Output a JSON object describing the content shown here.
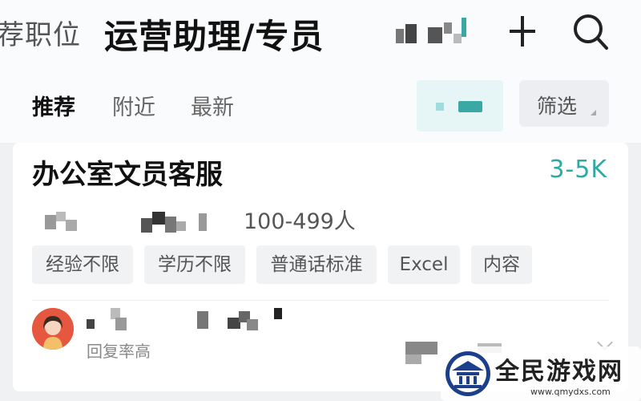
{
  "header": {
    "back_label": "荐职位",
    "title": "运营助理/专员",
    "add_icon": "plus-icon",
    "search_icon": "search-icon"
  },
  "tabs": [
    {
      "label": "推荐",
      "active": true
    },
    {
      "label": "附近",
      "active": false
    },
    {
      "label": "最新",
      "active": false
    }
  ],
  "filter": {
    "label": "筛选",
    "icon": "caret-icon"
  },
  "job": {
    "title": "办公室文员客服",
    "salary": "3-5K",
    "company_size": "100-499人",
    "tags": [
      "经验不限",
      "学历不限",
      "普通话标准",
      "Excel",
      "内容"
    ],
    "recruiter_status": "回复率高"
  },
  "watermark": {
    "text": "全民游戏网",
    "url": "www.qmydxs.com"
  },
  "colors": {
    "accent": "#2fa9a3",
    "avatar": "#e6573f",
    "watermark_blue": "#1c3f8c"
  }
}
